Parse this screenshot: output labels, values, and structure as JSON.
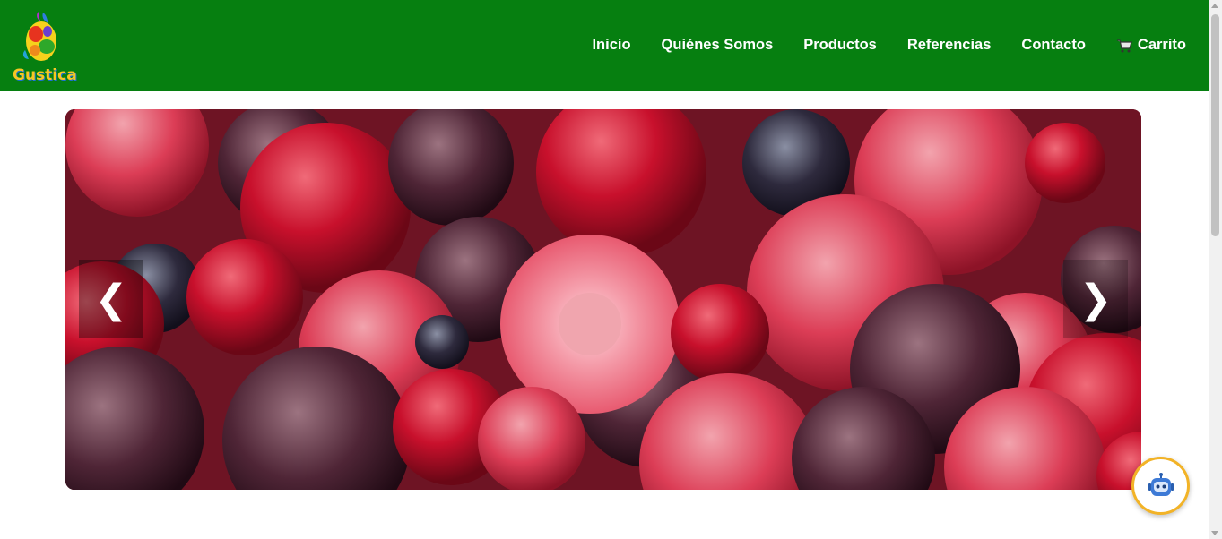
{
  "brand": {
    "name": "Gustica"
  },
  "nav": {
    "items": [
      {
        "label": "Inicio"
      },
      {
        "label": "Quiénes Somos"
      },
      {
        "label": "Productos"
      },
      {
        "label": "Referencias"
      },
      {
        "label": "Contacto"
      },
      {
        "label": "Carrito",
        "icon": "cart-icon"
      }
    ]
  },
  "carousel": {
    "slide_image": "frozen-berries",
    "prev_label": "❮",
    "next_label": "❯"
  },
  "chatbot": {
    "icon": "robot-icon"
  },
  "colors": {
    "navbar": "#067f10",
    "nav_text": "#ffffff",
    "chatbot_border": "#f2b327"
  }
}
